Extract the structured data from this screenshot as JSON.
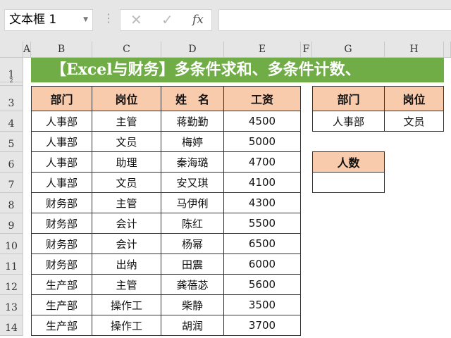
{
  "name_box": "文本框 1",
  "formula_bar": {
    "cancel": "✕",
    "enter": "✓",
    "fx": "fx",
    "value": ""
  },
  "columns": [
    "A",
    "B",
    "C",
    "D",
    "E",
    "F",
    "G",
    "H"
  ],
  "rows": [
    "1",
    "2",
    "3",
    "4",
    "5",
    "6",
    "7",
    "8",
    "9",
    "10",
    "11",
    "12",
    "13",
    "14"
  ],
  "title": "【Excel与财务】多条件求和、多条件计数、",
  "table": {
    "headers": [
      "部门",
      "岗位",
      "姓　名",
      "工资"
    ],
    "rows": [
      [
        "人事部",
        "主管",
        "蒋勤勤",
        "4500"
      ],
      [
        "人事部",
        "文员",
        "梅婷",
        "5000"
      ],
      [
        "人事部",
        "助理",
        "秦海璐",
        "4700"
      ],
      [
        "人事部",
        "文员",
        "安又琪",
        "4100"
      ],
      [
        "财务部",
        "主管",
        "马伊俐",
        "4300"
      ],
      [
        "财务部",
        "会计",
        "陈红",
        "5500"
      ],
      [
        "财务部",
        "会计",
        "杨幂",
        "6500"
      ],
      [
        "财务部",
        "出纳",
        "田震",
        "6000"
      ],
      [
        "生产部",
        "主管",
        "龚蓓苾",
        "5600"
      ],
      [
        "生产部",
        "操作工",
        "柴静",
        "3500"
      ],
      [
        "生产部",
        "操作工",
        "胡润",
        "3700"
      ]
    ]
  },
  "criteria": {
    "headers": [
      "部门",
      "岗位"
    ],
    "values": [
      "人事部",
      "文员"
    ]
  },
  "count": {
    "label": "人数",
    "value": ""
  }
}
